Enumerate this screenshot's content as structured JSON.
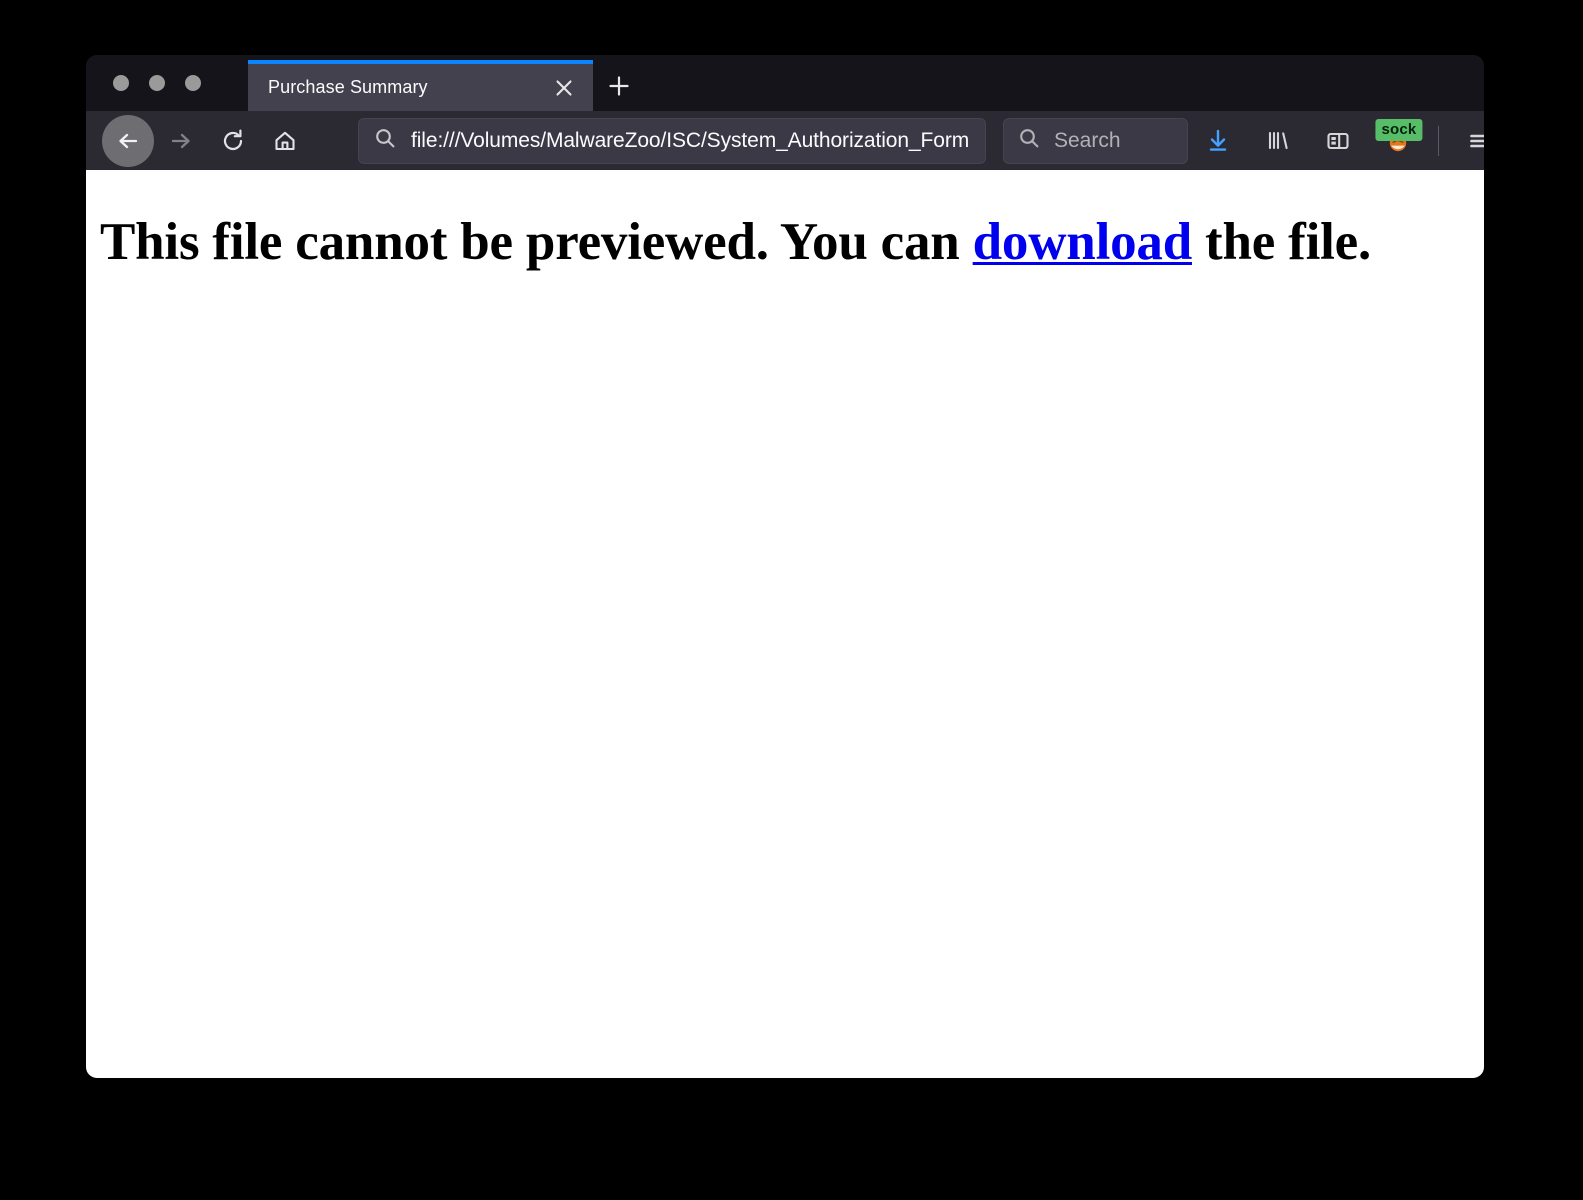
{
  "window": {
    "traffic_lights": [
      "close",
      "minimize",
      "zoom"
    ]
  },
  "tabstrip": {
    "active_tab": {
      "title": "Purchase Summary",
      "close_icon": "close-icon"
    },
    "new_tab_label": "+",
    "accent_color": "#0a84ff"
  },
  "toolbar": {
    "back_label": "Back",
    "forward_label": "Forward",
    "reload_label": "Reload",
    "home_label": "Home",
    "url": "file:///Volumes/MalwareZoo/ISC/System_Authorization_Form",
    "url_icon": "search-icon",
    "search": {
      "placeholder": "Search",
      "icon": "search-icon",
      "value": ""
    },
    "right_icons": [
      {
        "name": "downloads-icon",
        "label": "Downloads",
        "color": "#45a1ff"
      },
      {
        "name": "library-icon",
        "label": "Library"
      },
      {
        "name": "sidebar-icon",
        "label": "Sidebars"
      },
      {
        "name": "container-account-icon",
        "label": "Container",
        "badge": "sock",
        "badge_color": "#57bd68"
      },
      {
        "name": "hamburger-menu-icon",
        "label": "Open application menu"
      }
    ]
  },
  "content": {
    "heading_before": "This file cannot be previewed. You can ",
    "link_text": "download",
    "heading_after": " the file."
  }
}
